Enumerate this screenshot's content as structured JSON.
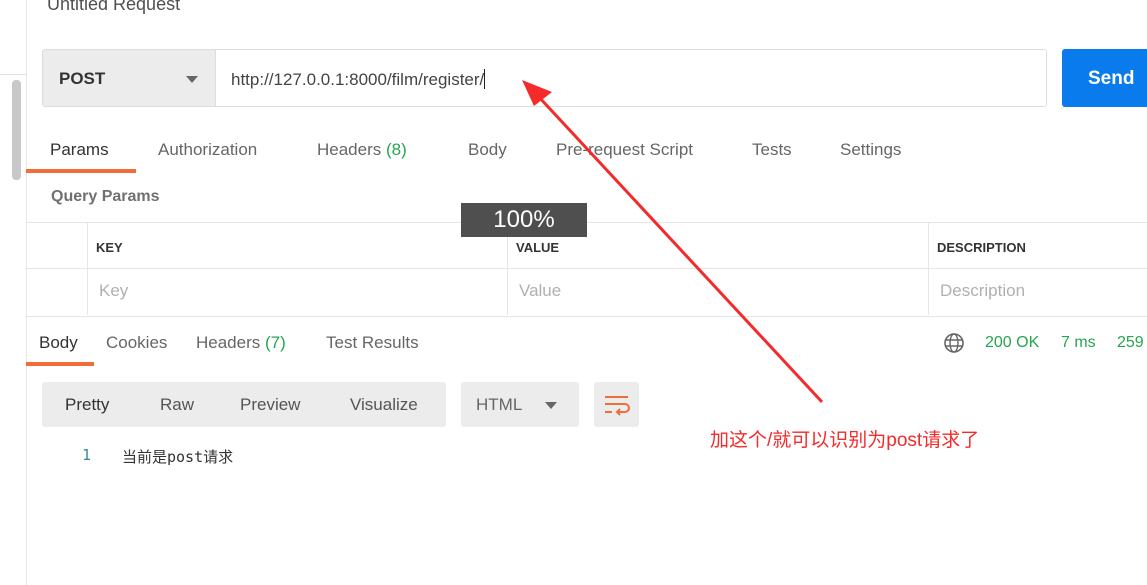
{
  "request": {
    "title": "Untitled Request",
    "method": "POST",
    "url": "http://127.0.0.1:8000/film/register/",
    "send_label": "Send"
  },
  "req_tabs": [
    {
      "label": "Params"
    },
    {
      "label": "Authorization"
    },
    {
      "label": "Headers",
      "count": "(8)"
    },
    {
      "label": "Body"
    },
    {
      "label": "Pre-request Script"
    },
    {
      "label": "Tests"
    },
    {
      "label": "Settings"
    }
  ],
  "params": {
    "title": "Query Params",
    "headers": [
      "KEY",
      "VALUE",
      "DESCRIPTION"
    ],
    "placeholders": [
      "Key",
      "Value",
      "Description"
    ]
  },
  "zoom_overlay": "100%",
  "resp_tabs": [
    {
      "label": "Body"
    },
    {
      "label": "Cookies"
    },
    {
      "label": "Headers",
      "count": "(7)"
    },
    {
      "label": "Test Results"
    }
  ],
  "status": {
    "code": "200 OK",
    "time": "7 ms",
    "size": "259",
    "icon": "globe-icon"
  },
  "view_modes": [
    "Pretty",
    "Raw",
    "Preview",
    "Visualize"
  ],
  "format": "HTML",
  "body_lines": [
    {
      "n": "1",
      "text": "当前是post请求"
    }
  ],
  "annotation": "加这个/就可以识别为post请求了",
  "colors": {
    "accent": "#f06d38",
    "send": "#097bed",
    "status": "#26a550",
    "annotation": "#f52a2a"
  }
}
